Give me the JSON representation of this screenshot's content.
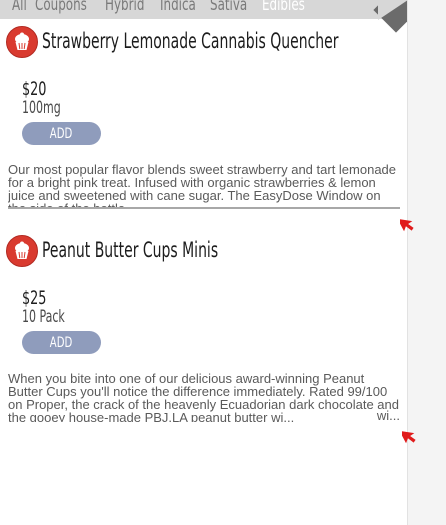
{
  "tabs": [
    {
      "label": "All"
    },
    {
      "label": "Coupons"
    },
    {
      "label": "Hybrid"
    },
    {
      "label": "Indica"
    },
    {
      "label": "Sativa"
    },
    {
      "label": "Edibles",
      "active": true
    }
  ],
  "products": [
    {
      "title": "Strawberry Lemonade Cannabis Quencher",
      "price": "$20",
      "quantity": "100mg",
      "add_label": "ADD",
      "description": "Our most popular flavor blends sweet strawberry and tart lemonade for a bright pink treat. Infused with organic strawberries & lemon juice and sweetened with cane sugar. The EasyDose Window on the side of the bottle."
    },
    {
      "title": "Peanut Butter Cups Minis",
      "price": "$25",
      "quantity": "10 Pack",
      "add_label": "ADD",
      "description": "When you bite into one of our delicious award-winning Peanut Butter Cups you'll notice the difference immediately. Rated 99/100 on Proper, the crack of the heavenly Ecuadorian dark chocolate and the gooey house-made PBJ.LA peanut butter wi...",
      "truncation": "wi..."
    }
  ],
  "icons": {
    "product_badge": "cupcake-icon",
    "pointer": "red-arrow-cursor-icon"
  },
  "colors": {
    "badge": "#d93a2f",
    "add_button": "#8f9cbc",
    "active_tab": "#ffffff",
    "cursor": "#e01b1b"
  }
}
